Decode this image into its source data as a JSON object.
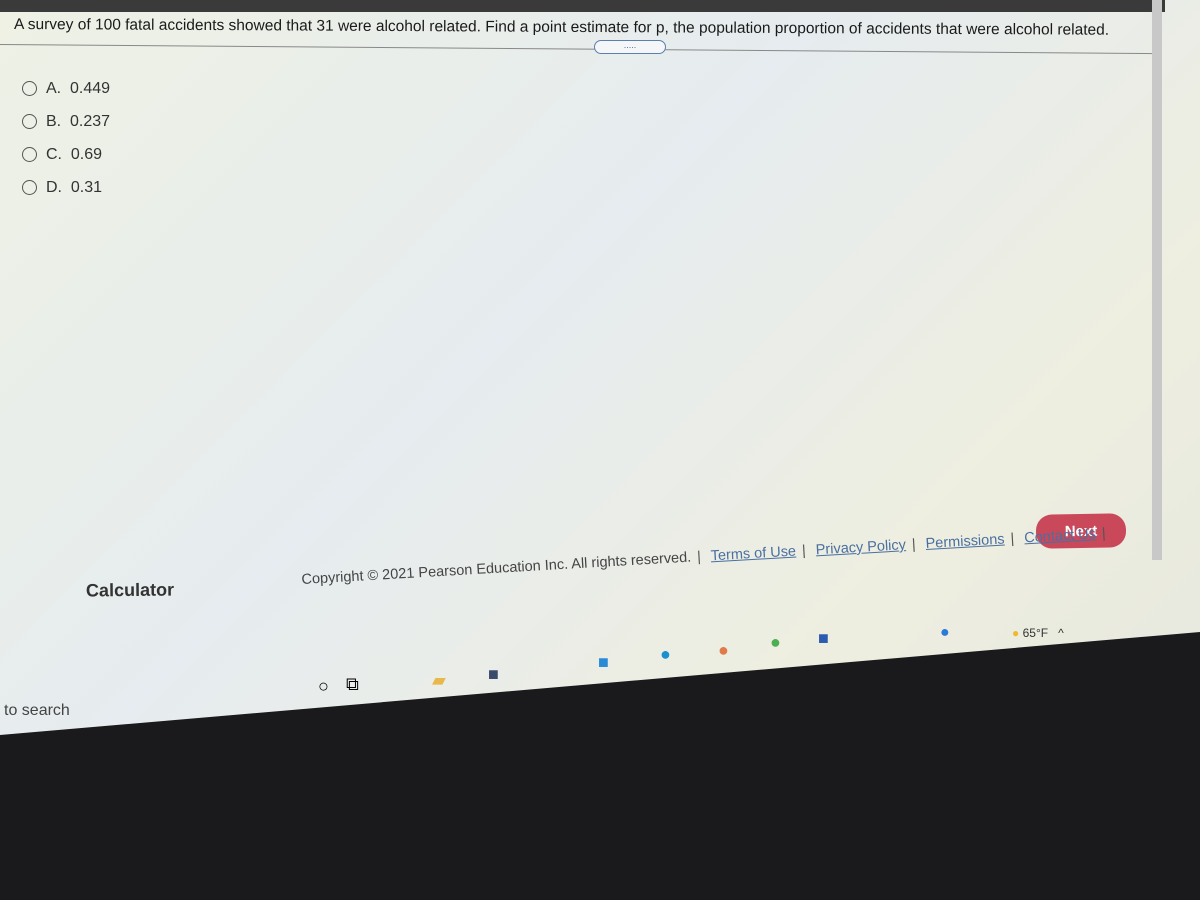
{
  "question": "A survey of 100 fatal accidents showed that 31 were alcohol related. Find a point estimate for p, the population proportion of accidents that were alcohol related.",
  "more_label": ".....",
  "options": [
    {
      "letter": "A.",
      "value": "0.449"
    },
    {
      "letter": "B.",
      "value": "0.237"
    },
    {
      "letter": "C.",
      "value": "0.69"
    },
    {
      "letter": "D.",
      "value": "0.31"
    }
  ],
  "next_label": "Next",
  "calculator_label": "Calculator",
  "footer": {
    "copyright": "Copyright © 2021 Pearson Education Inc. All rights reserved.",
    "links": [
      "Terms of Use",
      "Privacy Policy",
      "Permissions",
      "Contact Us"
    ]
  },
  "taskbar": {
    "search_text": "to search",
    "weather": "65°F",
    "apps": [
      "start-search-icon",
      "task-view-icon",
      "file-explorer-icon",
      "store-icon",
      "app-icon",
      "edge-icon",
      "app-orange-icon",
      "chrome-icon",
      "word-icon"
    ]
  },
  "colors": {
    "next_button": "#c9485a",
    "link": "#4a6fa0"
  }
}
